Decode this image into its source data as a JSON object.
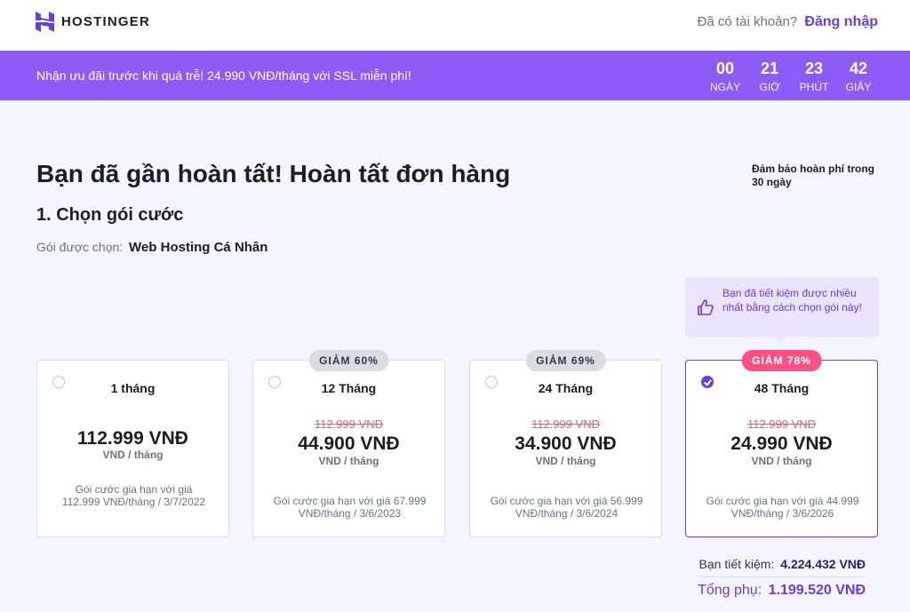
{
  "header": {
    "logo_text": "HOSTINGER",
    "account_question": "Đã có tài khoản?",
    "login_link": "Đăng nhập"
  },
  "promo": {
    "text": "Nhận ưu đãi trước khi quá trễ! 24.990 VNĐ/tháng với SSL miễn phí!",
    "countdown": [
      {
        "value": "00",
        "label": "NGÀY"
      },
      {
        "value": "21",
        "label": "GIỜ"
      },
      {
        "value": "23",
        "label": "PHÚT"
      },
      {
        "value": "42",
        "label": "GIÂY"
      }
    ]
  },
  "main": {
    "title": "Bạn đã gần hoàn tất! Hoàn tất đơn hàng",
    "guarantee": "Đảm bảo hoàn phí trong 30 ngày",
    "step_title": "1. Chọn gói cước",
    "selected_label": "Gói được chọn:",
    "selected_plan": "Web Hosting Cá Nhân",
    "tip": "Bạn đã tiết kiệm được nhiều nhất bằng cách chọn gói này!"
  },
  "plans": [
    {
      "period": "1 tháng",
      "badge": "",
      "old_price": "",
      "price": "112.999 VNĐ",
      "per": "VND / tháng",
      "renew": "Gói cước gia hạn với giá 112.999 VNĐ/tháng / 3/7/2022",
      "selected": false
    },
    {
      "period": "12 Tháng",
      "badge": "GIẢM 60%",
      "old_price": "112.999 VNĐ",
      "price": "44.900 VNĐ",
      "per": "VND / tháng",
      "renew": "Gói cước gia hạn với giá 67.999 VNĐ/tháng / 3/6/2023",
      "selected": false
    },
    {
      "period": "24 Tháng",
      "badge": "GIẢM 69%",
      "old_price": "112.999 VNĐ",
      "price": "34.900 VNĐ",
      "per": "VND / tháng",
      "renew": "Gói cước gia hạn với giá 56.999 VNĐ/tháng / 3/6/2024",
      "selected": false
    },
    {
      "period": "48 Tháng",
      "badge": "GIẢM 78%",
      "old_price": "112.999 VNĐ",
      "price": "24.990 VNĐ",
      "per": "VND / tháng",
      "renew": "Gói cước gia hạn với giá 44.999 VNĐ/tháng / 3/6/2026",
      "selected": true
    }
  ],
  "summary": {
    "savings_label": "Bạn tiết kiệm:",
    "savings_value": "4.224.432 VNĐ",
    "total_label": "Tổng phụ:",
    "total_value": "1.199.520 VNĐ"
  },
  "colors": {
    "brand": "#673de6",
    "promo_bg": "#8c5cf6",
    "discount_badge": "#fc5185"
  }
}
